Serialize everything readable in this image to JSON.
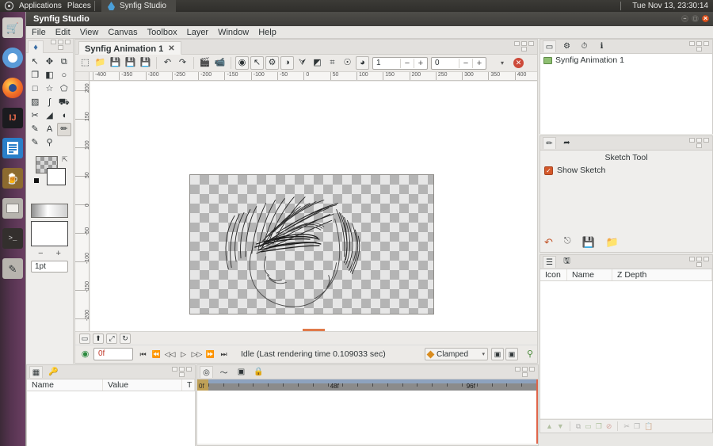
{
  "unity": {
    "dash_icon": "ubuntu-dash-icon",
    "applications_label": "Applications",
    "places_label": "Places",
    "app_icon": "synfig-app-icon",
    "app_label": "Synfig Studio",
    "clock": "Tue Nov 13, 23:30:14"
  },
  "launcher": {
    "items": [
      {
        "name": "ubuntu-software-center",
        "glyph": "🛒"
      },
      {
        "name": "chromium-browser",
        "glyph": "●"
      },
      {
        "name": "firefox-browser",
        "glyph": "●"
      },
      {
        "name": "intellij-idea",
        "glyph": "IJ"
      },
      {
        "name": "libreoffice-writer",
        "glyph": ""
      },
      {
        "name": "gimp",
        "glyph": "🏺"
      },
      {
        "name": "files-manager",
        "glyph": "▭"
      },
      {
        "name": "terminal",
        "glyph": ">_"
      },
      {
        "name": "synfig-studio",
        "glyph": "✎"
      }
    ]
  },
  "window": {
    "title": "Synfig Studio",
    "buttons": {
      "minimize": "–",
      "maximize": "□",
      "close": "✕"
    },
    "menu": [
      "File",
      "Edit",
      "View",
      "Canvas",
      "Toolbox",
      "Layer",
      "Window",
      "Help"
    ]
  },
  "toolbox": {
    "tab_icon": "synfig-logo-icon",
    "tools": [
      {
        "name": "transform-tool",
        "glyph": "↖"
      },
      {
        "name": "smooth-move-tool",
        "glyph": "✥"
      },
      {
        "name": "mirror-tool",
        "glyph": "⧉"
      },
      {
        "name": "scale-tool",
        "glyph": "❐"
      },
      {
        "name": "rotate-tool",
        "glyph": "◧"
      },
      {
        "name": "circle-tool",
        "glyph": "○"
      },
      {
        "name": "rectangle-tool",
        "glyph": "□"
      },
      {
        "name": "star-tool",
        "glyph": "☆"
      },
      {
        "name": "polygon-tool",
        "glyph": "⬠"
      },
      {
        "name": "gradient-tool",
        "glyph": "▨"
      },
      {
        "name": "spline-tool",
        "glyph": "ʃ"
      },
      {
        "name": "fill-tool",
        "glyph": "⛟"
      },
      {
        "name": "cutout-tool",
        "glyph": "✂"
      },
      {
        "name": "width-tool",
        "glyph": "◢"
      },
      {
        "name": "eyedropper-tool",
        "glyph": "◖"
      },
      {
        "name": "draw-tool",
        "glyph": "✎"
      },
      {
        "name": "text-tool",
        "glyph": "A"
      },
      {
        "name": "sketch-tool",
        "glyph": "✏"
      },
      {
        "name": "brush-tool",
        "glyph": "✎"
      },
      {
        "name": "zoom-tool",
        "glyph": "⚲"
      }
    ],
    "active_tool_index": 17,
    "fill_swatch": "fill-color-swatch",
    "outline_swatch": "outline-color-swatch",
    "swap_icon": "swap-colors-icon",
    "reset_icon": "reset-colors-icon",
    "gradient_swatch": "gradient-swatch",
    "brush_preview": "brush-preview",
    "minus_label": "−",
    "plus_label": "+",
    "brush_size": "1pt"
  },
  "canvas_window": {
    "tab_label": "Synfig Animation 1",
    "tab_close": "✕",
    "toolbar": [
      {
        "name": "new-document-button",
        "glyph": "⬚"
      },
      {
        "name": "open-document-button",
        "glyph": "📁"
      },
      {
        "name": "save-button",
        "glyph": "💾"
      },
      {
        "name": "save-as-button",
        "glyph": "💾"
      },
      {
        "name": "save-all-button",
        "glyph": "💾"
      },
      {
        "name": "undo-button",
        "glyph": "↶"
      },
      {
        "name": "redo-button",
        "glyph": "↷"
      },
      {
        "name": "render-button",
        "glyph": "🎬"
      },
      {
        "name": "preview-button",
        "glyph": "📹"
      },
      {
        "name": "show-grid-button",
        "glyph": "◉"
      },
      {
        "name": "snap-to-grid-button",
        "glyph": "↖"
      },
      {
        "name": "render-options-button",
        "glyph": "⚙"
      },
      {
        "name": "background-rendering-button",
        "glyph": "◑"
      },
      {
        "name": "onion-skin-button",
        "glyph": "⮛"
      },
      {
        "name": "show-onion-skin-button",
        "glyph": "◩"
      },
      {
        "name": "toggle-grid-button",
        "glyph": "⌗"
      },
      {
        "name": "toggle-guides-button",
        "glyph": "☉"
      },
      {
        "name": "low-res-button",
        "glyph": "◕"
      }
    ],
    "spin_past": {
      "name": "past-onion-skin-count",
      "value": "1"
    },
    "spin_future": {
      "name": "future-onion-skin-count",
      "value": "0"
    },
    "spin_minus": "−",
    "spin_plus": "+",
    "dropdown_arrow": "▾",
    "close_canvas": "✕",
    "ruler_h_ticks": [
      "-400",
      "-350",
      "-300",
      "-250",
      "-200",
      "-150",
      "-100",
      "-50",
      "0",
      "50",
      "100",
      "150",
      "200",
      "250",
      "300",
      "350",
      "400"
    ],
    "ruler_v_ticks": [
      "200",
      "150",
      "100",
      "50",
      "0",
      "-50",
      "-100",
      "-150",
      "-200"
    ],
    "nav_buttons": [
      {
        "name": "fit-canvas-button",
        "glyph": "▭"
      },
      {
        "name": "zoom-in-button",
        "glyph": "⬆"
      },
      {
        "name": "zoom-fit-button",
        "glyph": "⤢"
      },
      {
        "name": "refresh-button",
        "glyph": "↻"
      }
    ],
    "time_value": "0f",
    "transport": [
      {
        "name": "seek-begin-button",
        "glyph": "⏮"
      },
      {
        "name": "seek-prev-keyframe-button",
        "glyph": "⏪"
      },
      {
        "name": "seek-prev-frame-button",
        "glyph": "◁◁"
      },
      {
        "name": "play-button",
        "glyph": "▷"
      },
      {
        "name": "seek-next-frame-button",
        "glyph": "▷▷"
      },
      {
        "name": "seek-next-keyframe-button",
        "glyph": "⏩"
      },
      {
        "name": "seek-end-button",
        "glyph": "⏭"
      }
    ],
    "status": "Idle (Last rendering time 0.109033 sec)",
    "interpolation": "Clamped",
    "interp_dropdown_arrow": "▾",
    "render_btn_1": "render-preview-button",
    "render_btn_2": "render-final-button",
    "focus_btn": "focus-point-button"
  },
  "canvas_browser": {
    "tabs": [
      {
        "name": "canvas-browser-tab",
        "glyph": "▭"
      },
      {
        "name": "library-tab",
        "glyph": "⚙"
      },
      {
        "name": "history-tab",
        "glyph": "⏱"
      },
      {
        "name": "info-tab",
        "glyph": "ℹ"
      }
    ],
    "selected_tab": 0,
    "item_label": "Synfig Animation 1"
  },
  "tool_options": {
    "tabs": [
      {
        "name": "tool-options-tab",
        "glyph": "✏"
      },
      {
        "name": "navigator-tab",
        "glyph": "➦"
      }
    ],
    "selected_tab": 0,
    "title": "Sketch Tool",
    "checkbox_label": "Show Sketch",
    "checkbox_checked": true,
    "check_glyph": "✓",
    "buttons": [
      {
        "name": "undo-sketch-button",
        "glyph": "↶"
      },
      {
        "name": "clear-sketch-button",
        "glyph": "⌫"
      },
      {
        "name": "save-sketch-button",
        "glyph": "💾"
      },
      {
        "name": "load-sketch-button",
        "glyph": "📂"
      }
    ]
  },
  "layers_panel": {
    "tabs": [
      {
        "name": "layers-tab",
        "glyph": "☰"
      },
      {
        "name": "keyframes-tab",
        "glyph": "🖫"
      }
    ],
    "selected_tab": 0,
    "columns": [
      "Icon",
      "Name",
      "Z Depth"
    ],
    "rows": [],
    "toolbar": [
      {
        "name": "raise-layer-button",
        "glyph": "▲"
      },
      {
        "name": "lower-layer-button",
        "glyph": "▼"
      },
      {
        "name": "group-layer-button",
        "glyph": "⧉"
      },
      {
        "name": "new-layer-button",
        "glyph": "▭"
      },
      {
        "name": "duplicate-layer-button",
        "glyph": "❐"
      },
      {
        "name": "delete-layer-button",
        "glyph": "⊘"
      },
      {
        "name": "cut-layer-button",
        "glyph": "✂"
      },
      {
        "name": "copy-layer-button",
        "glyph": "❐"
      },
      {
        "name": "paste-layer-button",
        "glyph": "📋"
      }
    ]
  },
  "params_panel": {
    "tabs": [
      {
        "name": "params-tab",
        "glyph": "▦"
      },
      {
        "name": "keyframe-tab",
        "glyph": "🔑"
      }
    ],
    "selected_tab": 0,
    "columns": [
      "Name",
      "Value",
      "T"
    ],
    "rows": []
  },
  "timetrack_panel": {
    "tabs": [
      {
        "name": "timetrack-tab",
        "glyph": "◎"
      },
      {
        "name": "curves-tab",
        "glyph": "〜"
      },
      {
        "name": "children-tab",
        "glyph": "▣"
      },
      {
        "name": "keyframes-tab",
        "glyph": "🔒"
      }
    ],
    "selected_tab": 0,
    "time_cursor": "0f",
    "tick_labels": [
      {
        "label": "0f",
        "pos_pct": 0
      },
      {
        "label": "48f",
        "pos_pct": 39
      },
      {
        "label": "96f",
        "pos_pct": 79
      }
    ],
    "tick_count": 22
  },
  "colors": {
    "accent_orange": "#e0551f",
    "launcher_purple": "#6b3f63",
    "panel_bg": "#efeeec",
    "timebar_gray": "#8b8b8b",
    "timebar_blue": "#8da2be",
    "time_red": "#c0392b"
  }
}
